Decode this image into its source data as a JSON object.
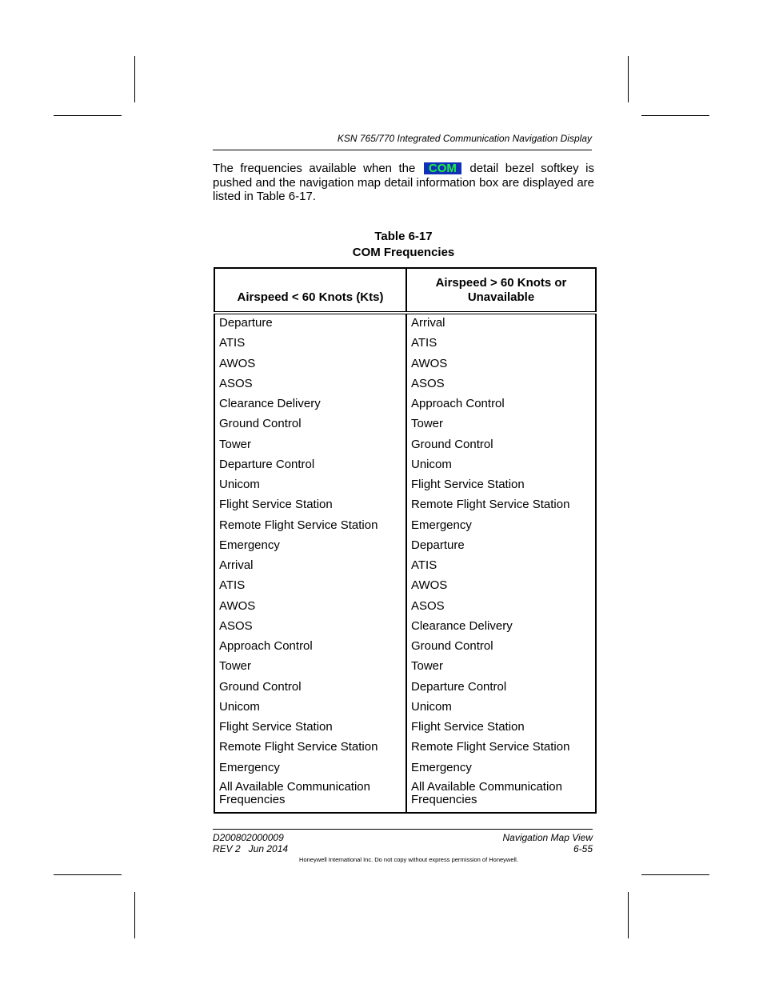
{
  "header": {
    "title": "KSN 765/770 Integrated Communication Navigation Display"
  },
  "intro": {
    "before": "The frequencies available when the ",
    "softkey_label": "COM",
    "after": " detail bezel softkey is pushed and the navigation map detail information box are displayed are listed in Table 6-17.",
    "softkey_bg": "#1030b8",
    "softkey_fg": "#20f040"
  },
  "table": {
    "number": "Table 6-17",
    "title": "COM Frequencies",
    "columns": [
      "Airspeed < 60 Knots (Kts)",
      "Airspeed > 60 Knots or Unavailable"
    ],
    "rows": [
      [
        "Departure",
        "Arrival"
      ],
      [
        "ATIS",
        "ATIS"
      ],
      [
        "AWOS",
        "AWOS"
      ],
      [
        "ASOS",
        "ASOS"
      ],
      [
        "Clearance Delivery",
        "Approach Control"
      ],
      [
        "Ground Control",
        "Tower"
      ],
      [
        "Tower",
        "Ground Control"
      ],
      [
        "Departure Control",
        "Unicom"
      ],
      [
        "Unicom",
        "Flight Service Station"
      ],
      [
        "Flight Service Station",
        "Remote Flight Service Station"
      ],
      [
        "Remote Flight Service Station",
        "Emergency"
      ],
      [
        "Emergency",
        "Departure"
      ],
      [
        "Arrival",
        "ATIS"
      ],
      [
        "ATIS",
        "AWOS"
      ],
      [
        "AWOS",
        "ASOS"
      ],
      [
        "ASOS",
        "Clearance Delivery"
      ],
      [
        "Approach Control",
        "Ground Control"
      ],
      [
        "Tower",
        "Tower"
      ],
      [
        "Ground Control",
        "Departure Control"
      ],
      [
        "Unicom",
        "Unicom"
      ],
      [
        "Flight Service Station",
        "Flight Service Station"
      ],
      [
        "Remote Flight Service Station",
        "Remote Flight Service Station"
      ],
      [
        "Emergency",
        "Emergency"
      ],
      [
        "All Available Communication Frequencies",
        "All Available Communication Frequencies"
      ]
    ]
  },
  "footer": {
    "doc_number": "D200802000009",
    "revision": "REV 2   Jun 2014",
    "section": "Navigation Map View",
    "page": "6-55",
    "copyright": "Honeywell International Inc. Do not copy without express permission of Honeywell."
  }
}
